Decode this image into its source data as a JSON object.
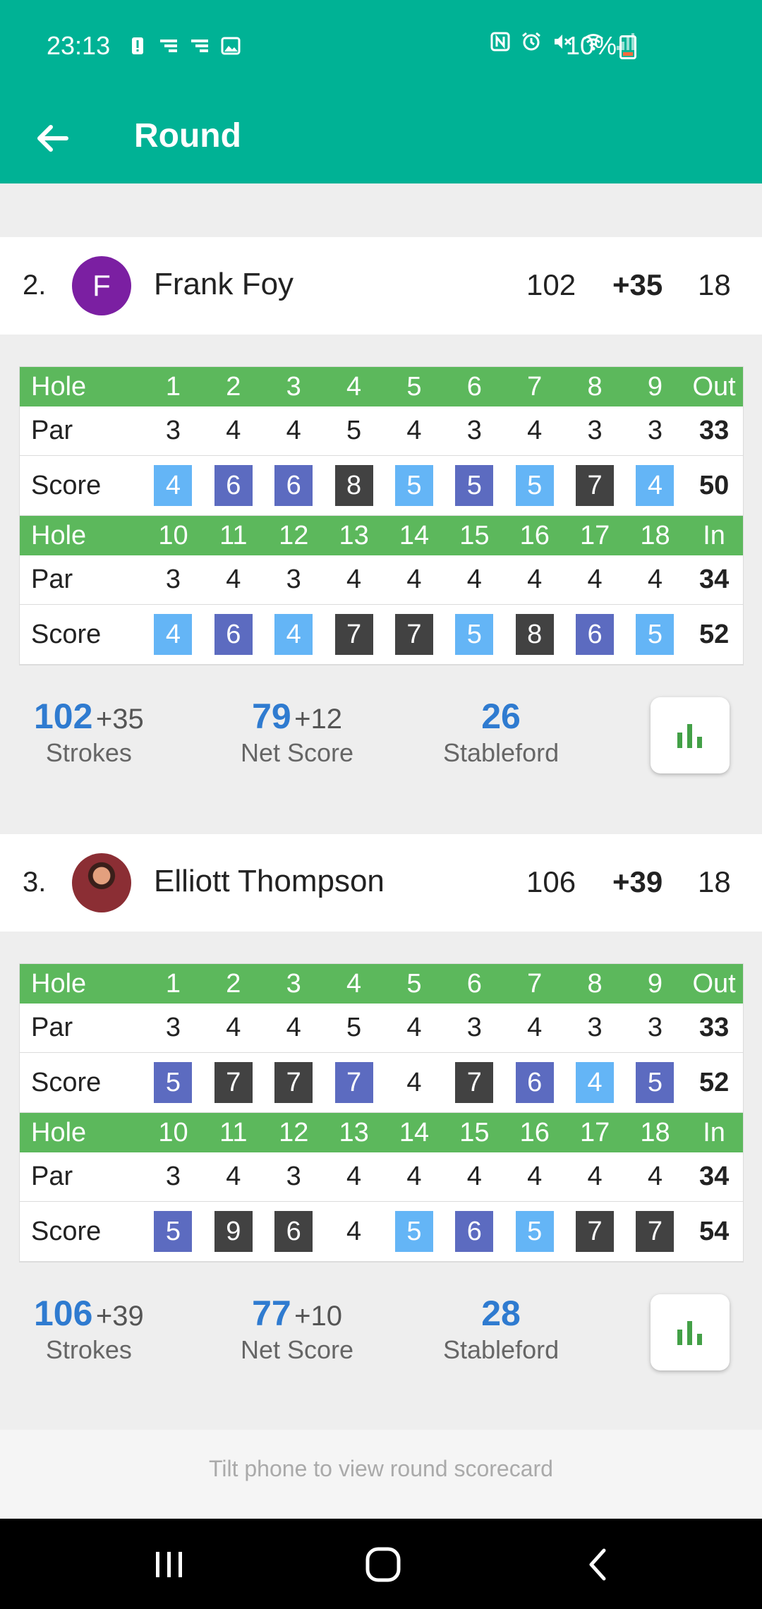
{
  "status_bar": {
    "time": "23:13",
    "battery": "10%"
  },
  "app_bar": {
    "title": "Round"
  },
  "players": [
    {
      "rank": "2.",
      "avatar_letter": "F",
      "name": "Frank Foy",
      "total": "102",
      "over": "+35",
      "holes": "18",
      "front": {
        "hole_label": "Hole",
        "par_label": "Par",
        "score_label": "Score",
        "holes": [
          "1",
          "2",
          "3",
          "4",
          "5",
          "6",
          "7",
          "8",
          "9"
        ],
        "total_label": "Out",
        "pars": [
          "3",
          "4",
          "4",
          "5",
          "4",
          "3",
          "4",
          "3",
          "3"
        ],
        "par_total": "33",
        "scores": [
          "4",
          "6",
          "6",
          "8",
          "5",
          "5",
          "5",
          "7",
          "4"
        ],
        "score_total": "50"
      },
      "back": {
        "hole_label": "Hole",
        "par_label": "Par",
        "score_label": "Score",
        "holes": [
          "10",
          "11",
          "12",
          "13",
          "14",
          "15",
          "16",
          "17",
          "18"
        ],
        "total_label": "In",
        "pars": [
          "3",
          "4",
          "3",
          "4",
          "4",
          "4",
          "4",
          "4",
          "4"
        ],
        "par_total": "34",
        "scores": [
          "4",
          "6",
          "4",
          "7",
          "7",
          "5",
          "8",
          "6",
          "5"
        ],
        "score_total": "52"
      },
      "stats": {
        "strokes": "102",
        "strokes_over": "+35",
        "strokes_label": "Strokes",
        "net": "79",
        "net_over": "+12",
        "net_label": "Net Score",
        "stableford": "26",
        "stableford_label": "Stableford"
      }
    },
    {
      "rank": "3.",
      "avatar_letter": "",
      "name": "Elliott Thompson",
      "total": "106",
      "over": "+39",
      "holes": "18",
      "front": {
        "hole_label": "Hole",
        "par_label": "Par",
        "score_label": "Score",
        "holes": [
          "1",
          "2",
          "3",
          "4",
          "5",
          "6",
          "7",
          "8",
          "9"
        ],
        "total_label": "Out",
        "pars": [
          "3",
          "4",
          "4",
          "5",
          "4",
          "3",
          "4",
          "3",
          "3"
        ],
        "par_total": "33",
        "scores": [
          "5",
          "7",
          "7",
          "7",
          "4",
          "7",
          "6",
          "4",
          "5"
        ],
        "score_total": "52"
      },
      "back": {
        "hole_label": "Hole",
        "par_label": "Par",
        "score_label": "Score",
        "holes": [
          "10",
          "11",
          "12",
          "13",
          "14",
          "15",
          "16",
          "17",
          "18"
        ],
        "total_label": "In",
        "pars": [
          "3",
          "4",
          "3",
          "4",
          "4",
          "4",
          "4",
          "4",
          "4"
        ],
        "par_total": "34",
        "scores": [
          "5",
          "9",
          "6",
          "4",
          "5",
          "6",
          "5",
          "7",
          "7"
        ],
        "score_total": "54"
      },
      "stats": {
        "strokes": "106",
        "strokes_over": "+39",
        "strokes_label": "Strokes",
        "net": "77",
        "net_over": "+10",
        "net_label": "Net Score",
        "stableford": "28",
        "stableford_label": "Stableford"
      }
    }
  ],
  "footer": {
    "hint": "Tilt phone to view round scorecard"
  },
  "colors": {
    "header": "#00b295",
    "hole_row": "#5cb85c",
    "bogey": "#64b5f6",
    "double_bogey": "#5c6bc0",
    "triple_plus": "#424242",
    "stat_value": "#2f7bd0"
  },
  "icons": [
    "arrow-left-icon",
    "bar-chart-icon",
    "recents-icon",
    "home-icon",
    "back-chevron-icon"
  ]
}
